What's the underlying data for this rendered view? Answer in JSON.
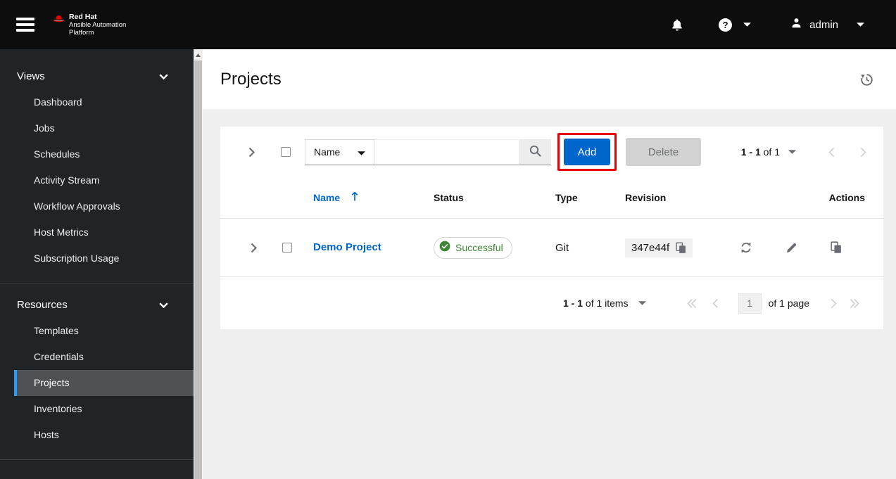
{
  "colors": {
    "primary_blue": "#0066cc",
    "success_green": "#3e8635",
    "nav_active_accent": "#2b9af3",
    "annotation_red": "#e60000",
    "masthead_bg": "#0d0d0d",
    "sidebar_bg": "#212427"
  },
  "masthead": {
    "brand_title": "Red Hat",
    "brand_subtitle_line1": "Ansible Automation",
    "brand_subtitle_line2": "Platform",
    "username": "admin",
    "icons": {
      "menu": "hamburger",
      "notifications": "bell",
      "help": "question-circle",
      "user": "person",
      "expand": "caret-down"
    }
  },
  "sidebar": {
    "sections": [
      {
        "label": "Views",
        "items": [
          {
            "label": "Dashboard"
          },
          {
            "label": "Jobs"
          },
          {
            "label": "Schedules"
          },
          {
            "label": "Activity Stream"
          },
          {
            "label": "Workflow Approvals"
          },
          {
            "label": "Host Metrics"
          },
          {
            "label": "Subscription Usage"
          }
        ]
      },
      {
        "label": "Resources",
        "items": [
          {
            "label": "Templates"
          },
          {
            "label": "Credentials"
          },
          {
            "label": "Projects",
            "active": true
          },
          {
            "label": "Inventories"
          },
          {
            "label": "Hosts"
          }
        ]
      }
    ]
  },
  "page": {
    "title": "Projects",
    "header_icon": "history"
  },
  "toolbar": {
    "filter_selected": "Name",
    "search_value": "",
    "add_label": "Add",
    "delete_label": "Delete",
    "pagination": {
      "range": "1 - 1",
      "of_total": "of 1"
    }
  },
  "table": {
    "headers": {
      "name": "Name",
      "status": "Status",
      "type": "Type",
      "revision": "Revision",
      "actions": "Actions"
    },
    "sort": {
      "column": "Name",
      "direction": "ascending"
    },
    "rows": [
      {
        "name": "Demo Project",
        "status": "Successful",
        "type": "Git",
        "revision": "347e44f",
        "actions": [
          "sync",
          "edit-pencil",
          "copy"
        ]
      }
    ]
  },
  "pagination_bottom": {
    "range": "1 - 1",
    "of_total": "of 1 items",
    "page_input": "1",
    "page_label": "of 1 page"
  }
}
